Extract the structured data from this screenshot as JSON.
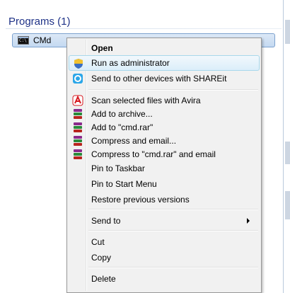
{
  "results": {
    "header": "Programs (1)",
    "item_label": "CMd",
    "item_icon": "cmd-icon"
  },
  "menu": {
    "items": [
      {
        "label": "Open",
        "icon": null
      },
      {
        "label": "Run as administrator",
        "icon": "shield-icon"
      },
      {
        "label": "Send to other devices with SHAREit",
        "icon": "shareit-icon"
      },
      {
        "label": "Scan selected files with Avira",
        "icon": "avira-icon"
      },
      {
        "label": "Add to archive...",
        "icon": "winrar-icon"
      },
      {
        "label": "Add to \"cmd.rar\"",
        "icon": "winrar-icon"
      },
      {
        "label": "Compress and email...",
        "icon": "winrar-icon"
      },
      {
        "label": "Compress to \"cmd.rar\" and email",
        "icon": "winrar-icon"
      },
      {
        "label": "Pin to Taskbar",
        "icon": null
      },
      {
        "label": "Pin to Start Menu",
        "icon": null
      },
      {
        "label": "Restore previous versions",
        "icon": null
      },
      {
        "label": "Send to",
        "icon": null
      },
      {
        "label": "Cut",
        "icon": null
      },
      {
        "label": "Copy",
        "icon": null
      },
      {
        "label": "Delete",
        "icon": null
      }
    ]
  },
  "colors": {
    "header_text": "#1e3287",
    "highlight_border": "#a8d8eb",
    "selection_fill": "#c4d9f1"
  }
}
